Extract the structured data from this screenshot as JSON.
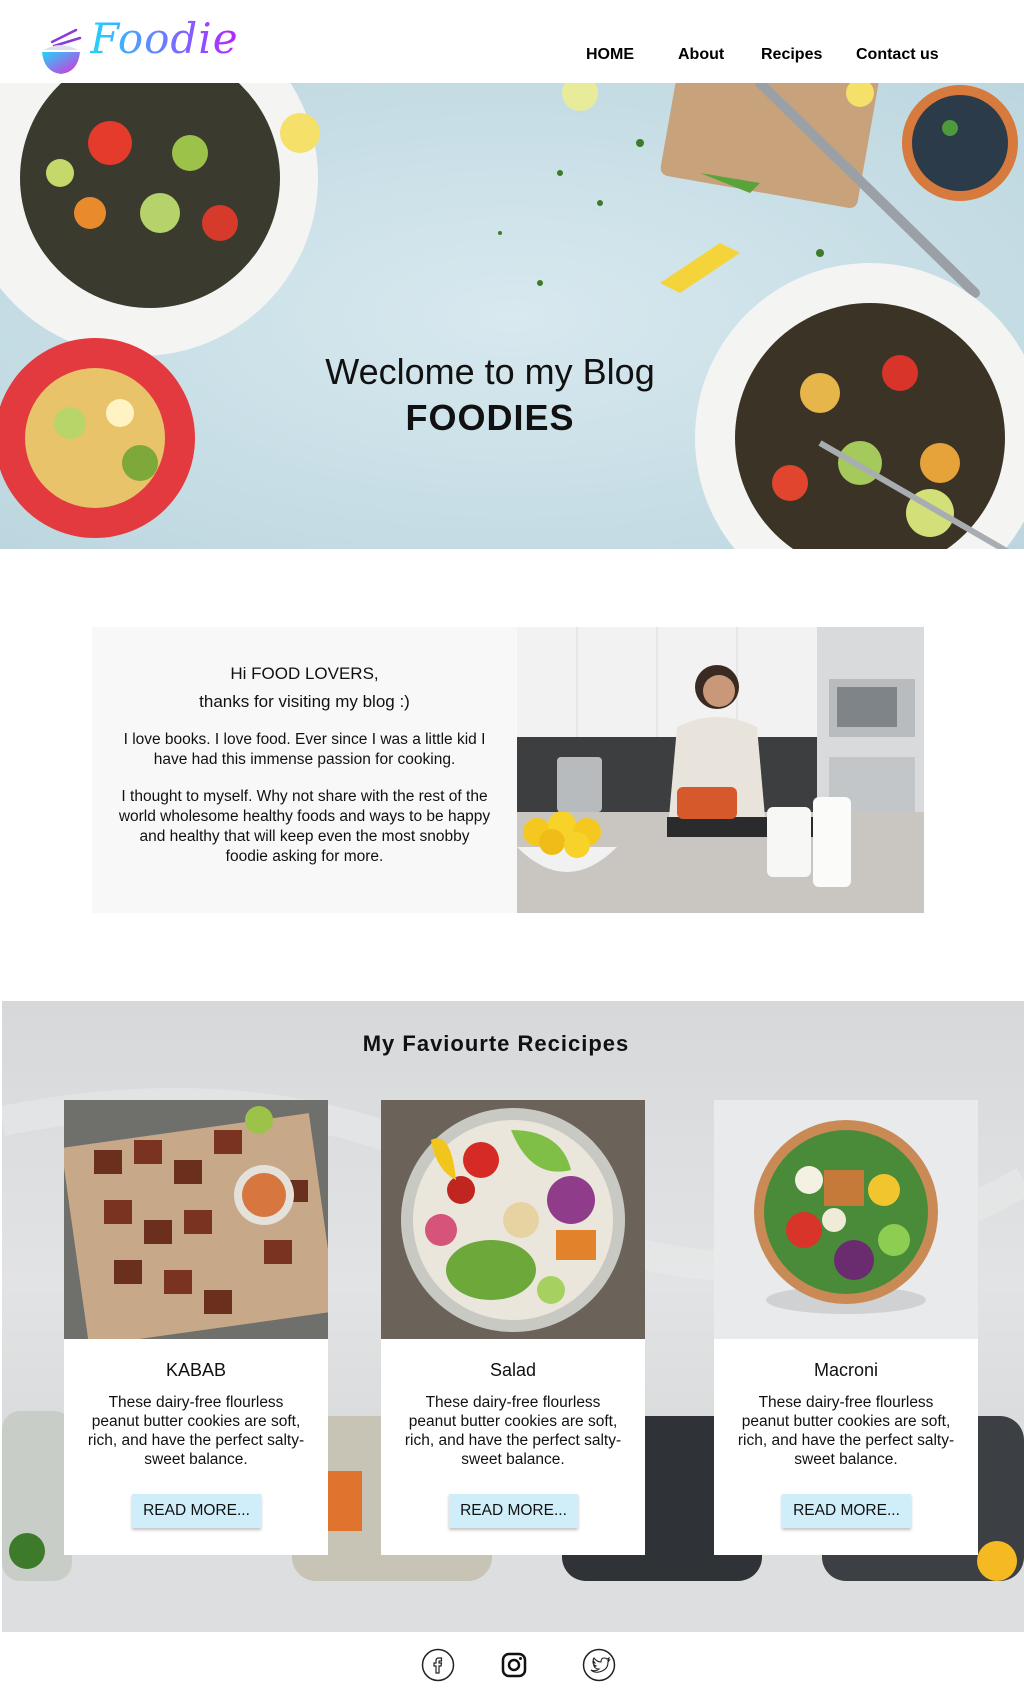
{
  "brand": {
    "name": "Foodie"
  },
  "nav": {
    "items": [
      {
        "label": "HOME"
      },
      {
        "label": "About"
      },
      {
        "label": "Recipes"
      },
      {
        "label": "Contact us"
      }
    ]
  },
  "hero": {
    "line1": "Weclome to my Blog",
    "line2": "FOODIES"
  },
  "about": {
    "greeting_prefix": "Hi ",
    "greeting_highlight": "FOOD LOVERS,",
    "thanks": "thanks for visiting my blog :)",
    "paragraph1": "I love books. I love food. Ever since I was a little kid I have had this immense passion for cooking.",
    "paragraph2": "I thought to myself. Why not share with the rest of the world wholesome healthy foods and ways to be happy and healthy that will keep even the most snobby foodie asking for more."
  },
  "recipes": {
    "title": "My Faviourte Recicipes",
    "cards": [
      {
        "name": "KABAB",
        "description": "These dairy-free flourless peanut butter cookies are soft, rich, and have the perfect salty-sweet balance.",
        "button": "READ MORE..."
      },
      {
        "name": "Salad",
        "description": "These dairy-free flourless peanut butter cookies are soft, rich, and have the perfect salty-sweet balance.",
        "button": "READ MORE..."
      },
      {
        "name": "Macroni",
        "description": "These dairy-free flourless peanut butter cookies are soft, rich, and have the perfect salty-sweet balance.",
        "button": "READ MORE..."
      }
    ]
  },
  "footer": {
    "icons": [
      "facebook-icon",
      "instagram-icon",
      "twitter-icon"
    ]
  },
  "colors": {
    "accent_button": "#cfeefa",
    "hero_bg": "#cfe3ea",
    "logo_gradient_start": "#21d4fd",
    "logo_gradient_end": "#b721ff"
  }
}
